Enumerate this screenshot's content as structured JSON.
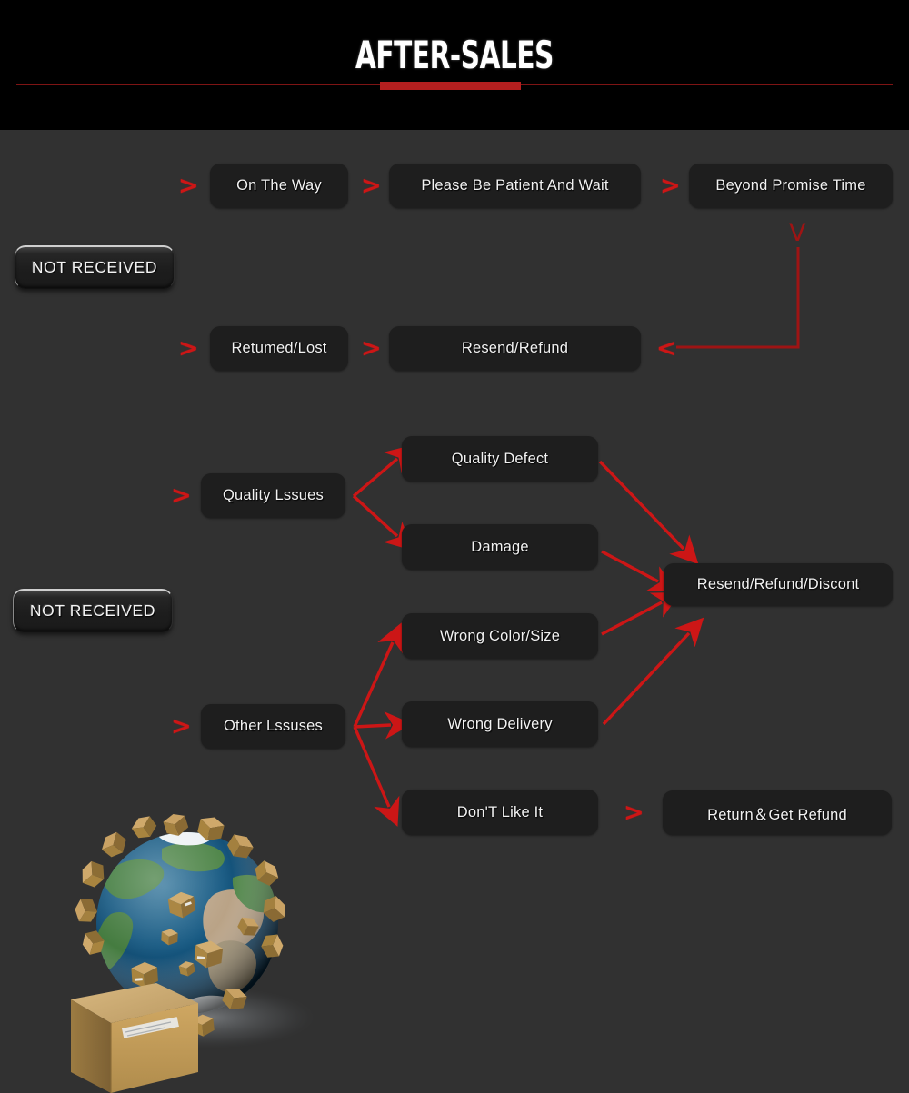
{
  "header": {
    "title": "AFTER-SALES",
    "accent_color": "#b41f1f",
    "rule_color": "#7e1414",
    "background": "#000000"
  },
  "theme": {
    "page_background": "#313131",
    "node_background": "#1e1e1e",
    "node_text": "#f2f2f2",
    "arrow_red": "#cc1616",
    "line_red": "#9e1414"
  },
  "flow": {
    "section_not_received_top": {
      "pill_label": "NOT RECEIVED",
      "row_shipping": [
        {
          "marker": ">",
          "label": "On The Way"
        },
        {
          "marker": ">",
          "label": "Please Be Patient And Wait"
        },
        {
          "marker": ">",
          "label": "Beyond Promise Time"
        }
      ],
      "row_returned": [
        {
          "marker": ">",
          "label": "Retumed/Lost"
        },
        {
          "marker": ">",
          "label": "Resend/Refund"
        }
      ],
      "loopback_marker": "<",
      "down_marker": "V"
    },
    "section_not_received_bottom": {
      "pill_label": "NOT RECEIVED",
      "branch_quality": {
        "marker": ">",
        "label": "Quality Lssues",
        "children": [
          "Quality Defect",
          "Damage"
        ]
      },
      "branch_other": {
        "marker": ">",
        "label": "Other Lssuses",
        "children": [
          "Wrong Color/Size",
          "Wrong Delivery",
          "Don'T Like It"
        ]
      },
      "outcome_primary": "Resend/Refund/Discont",
      "outcome_secondary": {
        "marker": ">",
        "label": "Return＆Get Refund"
      }
    }
  },
  "artwork": {
    "name": "globe-with-parcels-illustration",
    "alt": "3D globe covered in cardboard parcels with a large shipping box in front"
  }
}
